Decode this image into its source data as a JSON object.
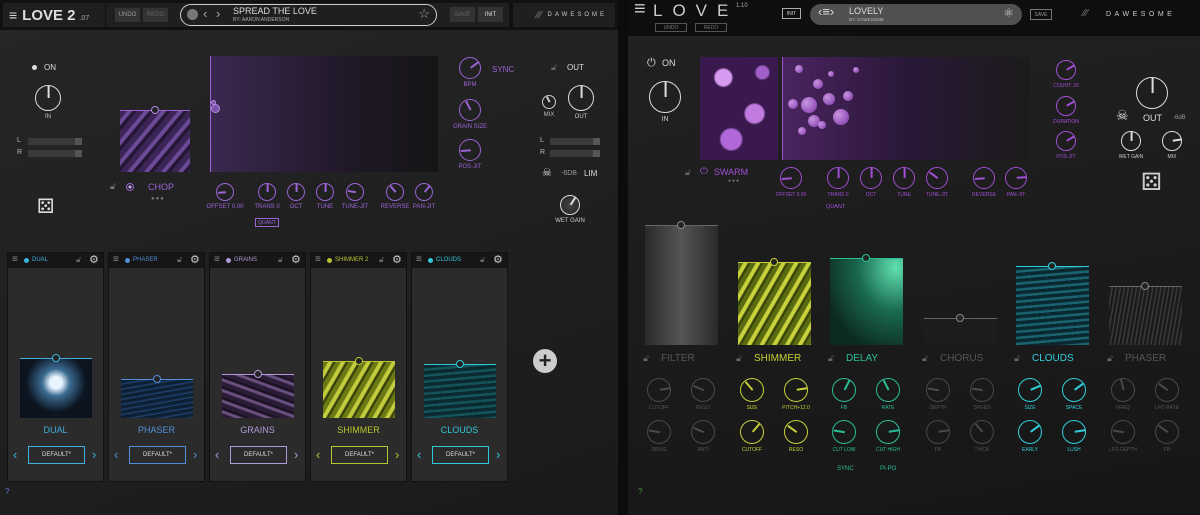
{
  "love2": {
    "logo": "LOVE 2",
    "version": ".07",
    "undo": "UNDO",
    "redo": "REDO",
    "preset": {
      "name": "SPREAD THE LOVE",
      "author": "BY: AARON ANDERSON"
    },
    "save": "SAVE",
    "init": "INIT",
    "brand": "DAWESOME",
    "on": "ON",
    "in": "IN",
    "meter_l": "L",
    "meter_r": "R",
    "engine": "CHOP",
    "sync": "SYNC",
    "out_title": "OUT",
    "lim_db": "-6dB",
    "lim": "LIM",
    "quant": "QUANT",
    "accent": "#9b63d6",
    "knobs": [
      {
        "label": "IN",
        "value": 0.5
      },
      {
        "label": "OFFSET 0.00",
        "value": 0.15
      },
      {
        "label": "TRANS 0",
        "value": 0.5
      },
      {
        "label": "OCT",
        "value": 0.5
      },
      {
        "label": "TUNE",
        "value": 0.5
      },
      {
        "label": "TUNE-JIT",
        "value": 0.2
      },
      {
        "label": "REVERSE",
        "value": 0.35
      },
      {
        "label": "PAN-JIT",
        "value": 0.65
      },
      {
        "label": "BPM",
        "value": 0.7
      },
      {
        "label": "GRAIN SIZE",
        "value": 0.4
      },
      {
        "label": "POS-JIT",
        "value": 0.15
      },
      {
        "label": "MIX",
        "value": 0.4
      },
      {
        "label": "OUT",
        "value": 0.5
      },
      {
        "label": "WET GAIN",
        "value": 0.62
      }
    ],
    "slots": [
      {
        "header": "DUAL",
        "name": "DUAL",
        "preset": "DEFAULT*",
        "color": "#3fb0e0"
      },
      {
        "header": "PHASER",
        "name": "PHASER",
        "preset": "DEFAULT*",
        "color": "#4f8fd8"
      },
      {
        "header": "GRAINS",
        "name": "GRAINS",
        "preset": "DEFAULT*",
        "color": "#b09ad8"
      },
      {
        "header": "SHIMMER 2",
        "name": "SHIMMER",
        "preset": "DEFAULT*",
        "color": "#b8c432"
      },
      {
        "header": "CLOUDS",
        "name": "CLOUDS",
        "preset": "DEFAULT*",
        "color": "#2fc8d6"
      }
    ],
    "add": "+",
    "help": "?"
  },
  "love1": {
    "logo": "LOVE",
    "version": "1.10",
    "undo": "UNDO",
    "redo": "REDO",
    "init": "INIT",
    "preset": {
      "name": "LOVELY",
      "author": "BY: DAWESOME"
    },
    "save": "SAVE",
    "brand": "DAWESOME",
    "on": "ON",
    "in": "IN",
    "engine": "SWARM",
    "quant": "QUANT",
    "out": "OUT",
    "out_db": "-6dB",
    "help": "?",
    "accent": "#a24fd6",
    "knobs": [
      {
        "label": "IN",
        "value": 0.5
      },
      {
        "label": "OFFSET 0.00",
        "value": 0.15
      },
      {
        "label": "TRANS 0",
        "value": 0.5
      },
      {
        "label": "OCT",
        "value": 0.5
      },
      {
        "label": "TUNE",
        "value": 0.5
      },
      {
        "label": "TUNE-JIT",
        "value": 0.3
      },
      {
        "label": "REVERSE",
        "value": 0.15
      },
      {
        "label": "PAN-JIT",
        "value": 0.82
      },
      {
        "label": "COUNT: 20",
        "value": 0.72
      },
      {
        "label": "DURATION",
        "value": 0.72
      },
      {
        "label": "POS-JIT",
        "value": 0.72
      },
      {
        "label": "OUT",
        "value": 0.5
      },
      {
        "label": "WET GAIN",
        "value": 0.5
      },
      {
        "label": "MIX",
        "value": 0.8
      }
    ],
    "fx": [
      {
        "name": "FILTER",
        "color": "#5a5a5a",
        "knobs": [
          {
            "label": "CUTOFF",
            "value": 0.8
          },
          {
            "label": "RESO",
            "value": 0.25
          },
          {
            "label": "DRIVE",
            "value": 0.2
          },
          {
            "label": "ANTI",
            "value": 0.25
          }
        ]
      },
      {
        "name": "SHIMMER",
        "color": "#c6cf38",
        "knobs": [
          {
            "label": "SIZE",
            "value": 0.35
          },
          {
            "label": "PITCH+12.0",
            "value": 0.8
          },
          {
            "label": "CUTOFF",
            "value": 0.65
          },
          {
            "label": "RESO",
            "value": 0.3
          }
        ]
      },
      {
        "name": "DELAY",
        "color": "#2bbf98",
        "knobs": [
          {
            "label": "FB",
            "value": 0.6
          },
          {
            "label": "RATE",
            "value": 0.4
          },
          {
            "label": "CUT LOW",
            "value": 0.2
          },
          {
            "label": "CUT HIGH",
            "value": 0.8
          }
        ],
        "extra": [
          "SYNC",
          "PI-PO"
        ]
      },
      {
        "name": "CHORUS",
        "color": "#5a5a5a",
        "knobs": [
          {
            "label": "DEPTH",
            "value": 0.2
          },
          {
            "label": "SPEED",
            "value": 0.2
          },
          {
            "label": "FB",
            "value": 0.8
          },
          {
            "label": "THICK",
            "value": 0.35
          }
        ]
      },
      {
        "name": "CLOUDS",
        "color": "#2fd0dc",
        "knobs": [
          {
            "label": "SIZE",
            "value": 0.75
          },
          {
            "label": "SPACE",
            "value": 0.7
          },
          {
            "label": "EARLY",
            "value": 0.7
          },
          {
            "label": "LUSH",
            "value": 0.8
          }
        ]
      },
      {
        "name": "PHASER",
        "color": "#5a5a5a",
        "knobs": [
          {
            "label": "FREQ",
            "value": 0.45
          },
          {
            "label": "LFO RATE",
            "value": 0.3
          },
          {
            "label": "LFO DEPTH",
            "value": 0.2
          },
          {
            "label": "FB",
            "value": 0.3
          }
        ]
      }
    ]
  }
}
